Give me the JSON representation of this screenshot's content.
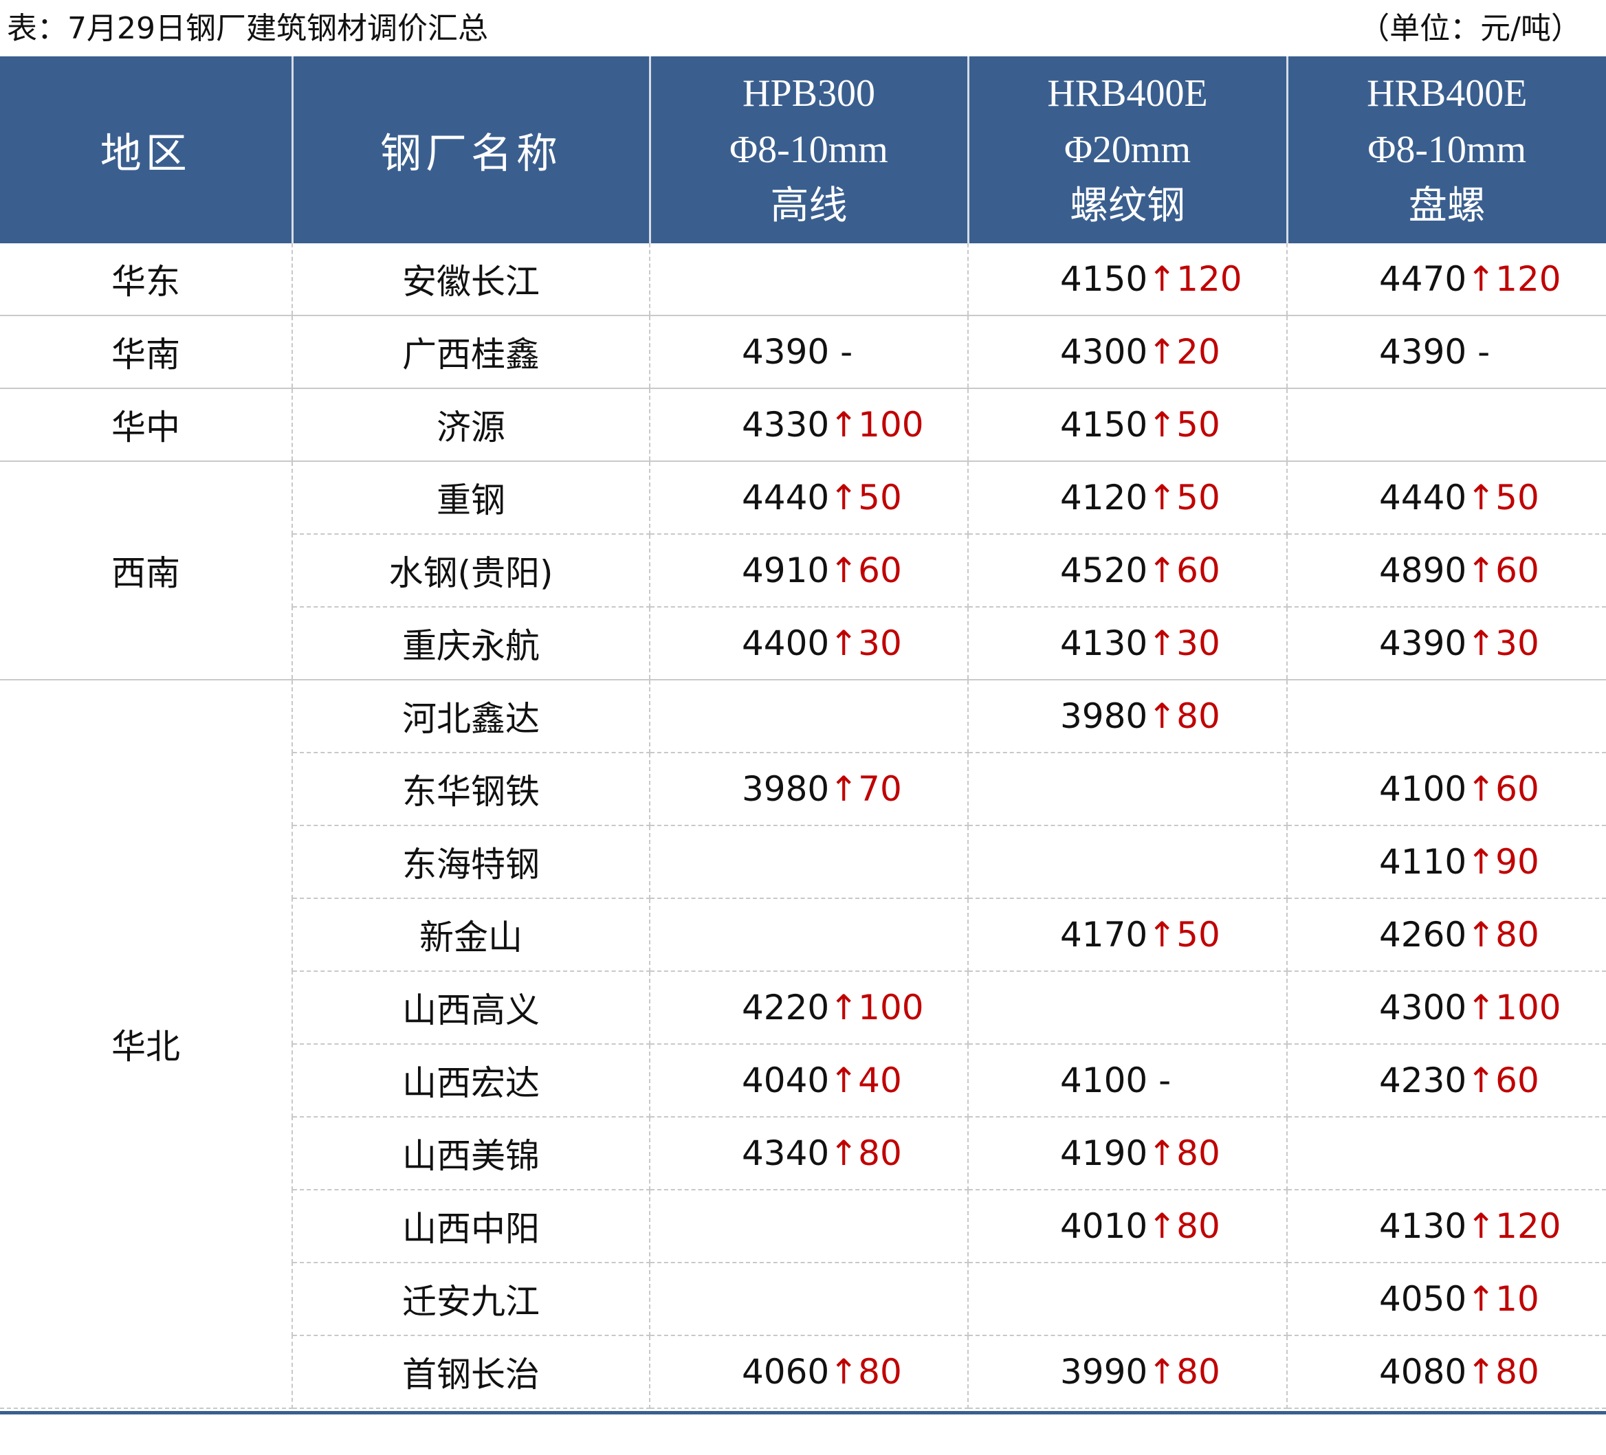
{
  "caption": "表：7月29日钢厂建筑钢材调价汇总",
  "unit": "（单位：元/吨）",
  "headers": {
    "region": "地区",
    "mill": "钢厂名称",
    "col1": [
      "HPB300",
      "Φ8-10mm",
      "高线"
    ],
    "col2": [
      "HRB400E",
      "Φ20mm",
      "螺纹钢"
    ],
    "col3": [
      "HRB400E",
      "Φ8-10mm",
      "盘螺"
    ]
  },
  "arrow_symbol": "↑",
  "no_change_symbol": "-",
  "colors": {
    "header_bg": "#3a5f8f",
    "header_text": "#ffffff",
    "increase": "#c00000"
  },
  "regions": [
    "华东",
    "华南",
    "华中",
    "西南",
    "华北"
  ],
  "rows": [
    {
      "mill": "安徽长江",
      "p1": {
        "price": "",
        "change": ""
      },
      "p2": {
        "price": "4150",
        "change": "120"
      },
      "p3": {
        "price": "4470",
        "change": "120"
      }
    },
    {
      "mill": "广西桂鑫",
      "p1": {
        "price": "4390",
        "change": "-"
      },
      "p2": {
        "price": "4300",
        "change": "20"
      },
      "p3": {
        "price": "4390",
        "change": "-"
      }
    },
    {
      "mill": "济源",
      "p1": {
        "price": "4330",
        "change": "100"
      },
      "p2": {
        "price": "4150",
        "change": "50"
      },
      "p3": {
        "price": "",
        "change": ""
      }
    },
    {
      "mill": "重钢",
      "p1": {
        "price": "4440",
        "change": "50"
      },
      "p2": {
        "price": "4120",
        "change": "50"
      },
      "p3": {
        "price": "4440",
        "change": "50"
      }
    },
    {
      "mill": "水钢(贵阳)",
      "p1": {
        "price": "4910",
        "change": "60"
      },
      "p2": {
        "price": "4520",
        "change": "60"
      },
      "p3": {
        "price": "4890",
        "change": "60"
      }
    },
    {
      "mill": "重庆永航",
      "p1": {
        "price": "4400",
        "change": "30"
      },
      "p2": {
        "price": "4130",
        "change": "30"
      },
      "p3": {
        "price": "4390",
        "change": "30"
      }
    },
    {
      "mill": "河北鑫达",
      "p1": {
        "price": "",
        "change": ""
      },
      "p2": {
        "price": "3980",
        "change": "80"
      },
      "p3": {
        "price": "",
        "change": ""
      }
    },
    {
      "mill": "东华钢铁",
      "p1": {
        "price": "3980",
        "change": "70"
      },
      "p2": {
        "price": "",
        "change": ""
      },
      "p3": {
        "price": "4100",
        "change": "60"
      }
    },
    {
      "mill": "东海特钢",
      "p1": {
        "price": "",
        "change": ""
      },
      "p2": {
        "price": "",
        "change": ""
      },
      "p3": {
        "price": "4110",
        "change": "90"
      }
    },
    {
      "mill": "新金山",
      "p1": {
        "price": "",
        "change": ""
      },
      "p2": {
        "price": "4170",
        "change": "50"
      },
      "p3": {
        "price": "4260",
        "change": "80"
      }
    },
    {
      "mill": "山西高义",
      "p1": {
        "price": "4220",
        "change": "100"
      },
      "p2": {
        "price": "",
        "change": ""
      },
      "p3": {
        "price": "4300",
        "change": "100"
      }
    },
    {
      "mill": "山西宏达",
      "p1": {
        "price": "4040",
        "change": "40"
      },
      "p2": {
        "price": "4100",
        "change": "-"
      },
      "p3": {
        "price": "4230",
        "change": "60"
      }
    },
    {
      "mill": "山西美锦",
      "p1": {
        "price": "4340",
        "change": "80"
      },
      "p2": {
        "price": "4190",
        "change": "80"
      },
      "p3": {
        "price": "",
        "change": ""
      }
    },
    {
      "mill": "山西中阳",
      "p1": {
        "price": "",
        "change": ""
      },
      "p2": {
        "price": "4010",
        "change": "80"
      },
      "p3": {
        "price": "4130",
        "change": "120"
      }
    },
    {
      "mill": "迁安九江",
      "p1": {
        "price": "",
        "change": ""
      },
      "p2": {
        "price": "",
        "change": ""
      },
      "p3": {
        "price": "4050",
        "change": "10"
      }
    },
    {
      "mill": "首钢长治",
      "p1": {
        "price": "4060",
        "change": "80"
      },
      "p2": {
        "price": "3990",
        "change": "80"
      },
      "p3": {
        "price": "4080",
        "change": "80"
      }
    }
  ]
}
